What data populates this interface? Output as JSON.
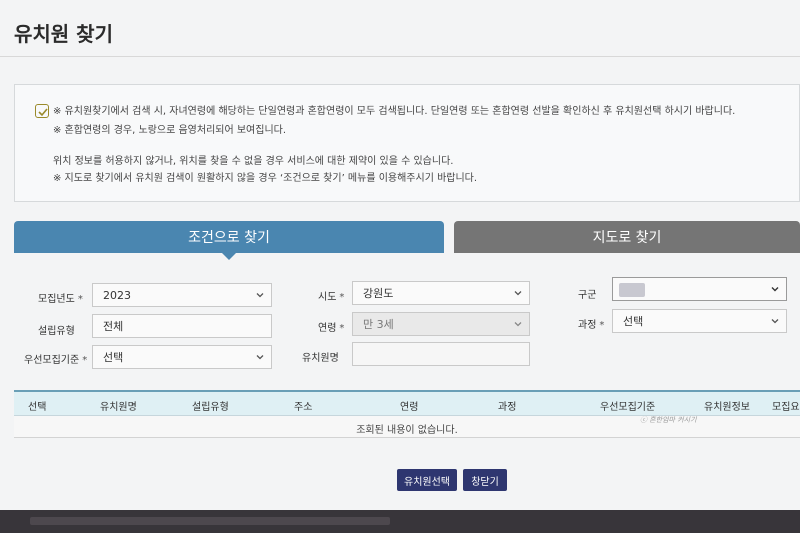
{
  "page": {
    "title": "유치원 찾기"
  },
  "notice": {
    "line1": "※ 유치원찾기에서 검색 시, 자녀연령에 해당하는 단일연령과 혼합연령이 모두 검색됩니다. 단일연령 또는 혼합연령 선발을 확인하신 후 유치원선택 하시기 바랍니다.",
    "line2": "※ 혼합연령의 경우, 노랑으로 음영처리되어 보여집니다.",
    "line3": "위치 정보를 허용하지 않거나, 위치를 찾을 수 없을 경우 서비스에 대한 제약이 있을 수 있습니다.",
    "line4": "※ 지도로 찾기에서 유치원 검색이 원활하지 않을 경우 ‘조건으로 찾기’ 메뉴를 이용해주시기 바랍니다."
  },
  "tabs": {
    "by_condition": "조건으로 찾기",
    "by_map": "지도로 찾기"
  },
  "form": {
    "required_mark": "*",
    "year": {
      "label": "모집년도",
      "value": "2023"
    },
    "sido": {
      "label": "시도",
      "value": "강원도"
    },
    "gugun": {
      "label": "구군",
      "value": ""
    },
    "type": {
      "label": "설립유형",
      "value": "전체"
    },
    "age": {
      "label": "연령",
      "value": "만 3세"
    },
    "course": {
      "label": "과정",
      "value": "선택"
    },
    "priority": {
      "label": "우선모집기준",
      "value": "선택"
    },
    "name": {
      "label": "유치원명",
      "value": ""
    }
  },
  "table": {
    "columns": [
      "선택",
      "유치원명",
      "설립유형",
      "주소",
      "연령",
      "과정",
      "우선모집기준",
      "유치원정보",
      "모집요"
    ],
    "empty_message": "조회된 내용이 없습니다."
  },
  "watermark": "ⓒ 흔한엄마 커시기",
  "buttons": {
    "select": "유치원선택",
    "close": "창닫기"
  }
}
